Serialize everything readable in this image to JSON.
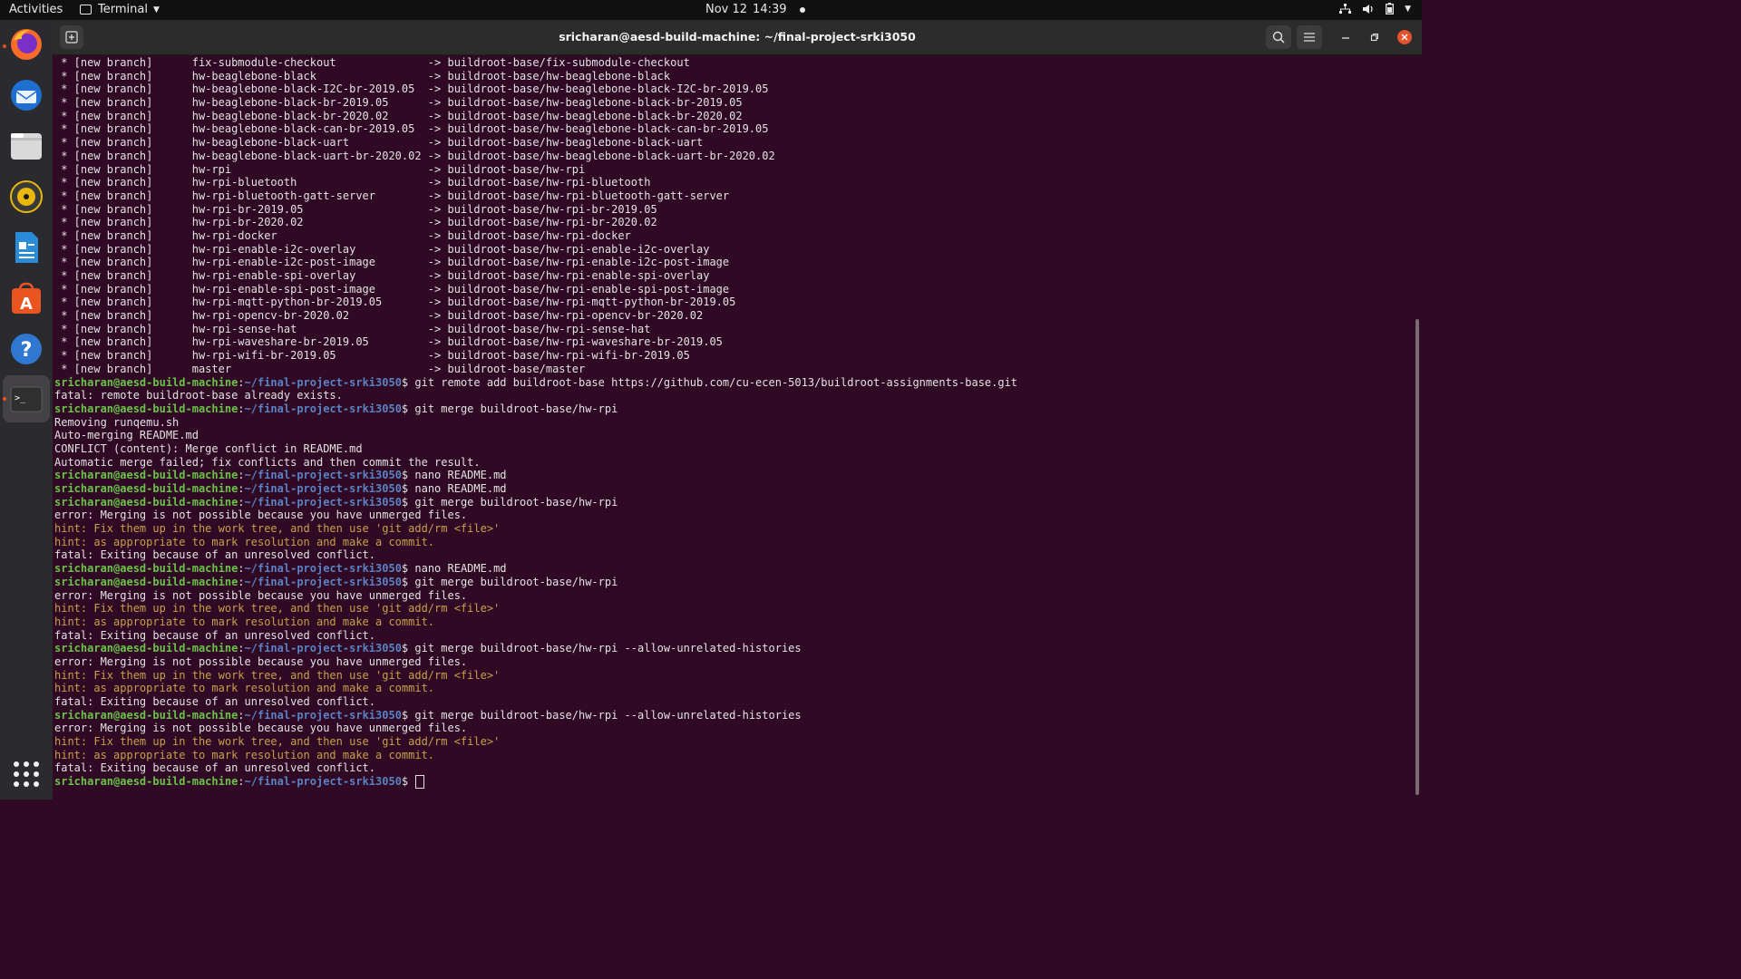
{
  "topbar": {
    "activities": "Activities",
    "app_name": "Terminal",
    "date": "Nov 12",
    "time": "14:39"
  },
  "dock": {
    "items": [
      "firefox-icon",
      "thunderbird-icon",
      "files-icon",
      "rhythmbox-icon",
      "libreoffice-writer-icon",
      "software-icon",
      "help-icon",
      "terminal-icon"
    ]
  },
  "window": {
    "title": "sricharan@aesd-build-machine: ~/final-project-srki3050"
  },
  "prompt": {
    "user": "sricharan@aesd-build-machine",
    "path": "~/final-project-srki3050"
  },
  "terminal_lines": [
    {
      "type": "out",
      "text": " * [new branch]      fix-submodule-checkout              -> buildroot-base/fix-submodule-checkout"
    },
    {
      "type": "out",
      "text": " * [new branch]      hw-beaglebone-black                 -> buildroot-base/hw-beaglebone-black"
    },
    {
      "type": "out",
      "text": " * [new branch]      hw-beaglebone-black-I2C-br-2019.05  -> buildroot-base/hw-beaglebone-black-I2C-br-2019.05"
    },
    {
      "type": "out",
      "text": " * [new branch]      hw-beaglebone-black-br-2019.05      -> buildroot-base/hw-beaglebone-black-br-2019.05"
    },
    {
      "type": "out",
      "text": " * [new branch]      hw-beaglebone-black-br-2020.02      -> buildroot-base/hw-beaglebone-black-br-2020.02"
    },
    {
      "type": "out",
      "text": " * [new branch]      hw-beaglebone-black-can-br-2019.05  -> buildroot-base/hw-beaglebone-black-can-br-2019.05"
    },
    {
      "type": "out",
      "text": " * [new branch]      hw-beaglebone-black-uart            -> buildroot-base/hw-beaglebone-black-uart"
    },
    {
      "type": "out",
      "text": " * [new branch]      hw-beaglebone-black-uart-br-2020.02 -> buildroot-base/hw-beaglebone-black-uart-br-2020.02"
    },
    {
      "type": "out",
      "text": " * [new branch]      hw-rpi                              -> buildroot-base/hw-rpi"
    },
    {
      "type": "out",
      "text": " * [new branch]      hw-rpi-bluetooth                    -> buildroot-base/hw-rpi-bluetooth"
    },
    {
      "type": "out",
      "text": " * [new branch]      hw-rpi-bluetooth-gatt-server        -> buildroot-base/hw-rpi-bluetooth-gatt-server"
    },
    {
      "type": "out",
      "text": " * [new branch]      hw-rpi-br-2019.05                   -> buildroot-base/hw-rpi-br-2019.05"
    },
    {
      "type": "out",
      "text": " * [new branch]      hw-rpi-br-2020.02                   -> buildroot-base/hw-rpi-br-2020.02"
    },
    {
      "type": "out",
      "text": " * [new branch]      hw-rpi-docker                       -> buildroot-base/hw-rpi-docker"
    },
    {
      "type": "out",
      "text": " * [new branch]      hw-rpi-enable-i2c-overlay           -> buildroot-base/hw-rpi-enable-i2c-overlay"
    },
    {
      "type": "out",
      "text": " * [new branch]      hw-rpi-enable-i2c-post-image        -> buildroot-base/hw-rpi-enable-i2c-post-image"
    },
    {
      "type": "out",
      "text": " * [new branch]      hw-rpi-enable-spi-overlay           -> buildroot-base/hw-rpi-enable-spi-overlay"
    },
    {
      "type": "out",
      "text": " * [new branch]      hw-rpi-enable-spi-post-image        -> buildroot-base/hw-rpi-enable-spi-post-image"
    },
    {
      "type": "out",
      "text": " * [new branch]      hw-rpi-mqtt-python-br-2019.05       -> buildroot-base/hw-rpi-mqtt-python-br-2019.05"
    },
    {
      "type": "out",
      "text": " * [new branch]      hw-rpi-opencv-br-2020.02            -> buildroot-base/hw-rpi-opencv-br-2020.02"
    },
    {
      "type": "out",
      "text": " * [new branch]      hw-rpi-sense-hat                    -> buildroot-base/hw-rpi-sense-hat"
    },
    {
      "type": "out",
      "text": " * [new branch]      hw-rpi-waveshare-br-2019.05         -> buildroot-base/hw-rpi-waveshare-br-2019.05"
    },
    {
      "type": "out",
      "text": " * [new branch]      hw-rpi-wifi-br-2019.05              -> buildroot-base/hw-rpi-wifi-br-2019.05"
    },
    {
      "type": "out",
      "text": " * [new branch]      master                              -> buildroot-base/master"
    },
    {
      "type": "cmd",
      "text": "$ git remote add buildroot-base https://github.com/cu-ecen-5013/buildroot-assignments-base.git"
    },
    {
      "type": "out",
      "text": "fatal: remote buildroot-base already exists."
    },
    {
      "type": "cmd",
      "text": "$ git merge buildroot-base/hw-rpi"
    },
    {
      "type": "out",
      "text": "Removing runqemu.sh"
    },
    {
      "type": "out",
      "text": "Auto-merging README.md"
    },
    {
      "type": "out",
      "text": "CONFLICT (content): Merge conflict in README.md"
    },
    {
      "type": "out",
      "text": "Automatic merge failed; fix conflicts and then commit the result."
    },
    {
      "type": "cmd",
      "text": "$ nano README.md"
    },
    {
      "type": "cmd",
      "text": "$ nano README.md"
    },
    {
      "type": "cmd",
      "text": "$ git merge buildroot-base/hw-rpi"
    },
    {
      "type": "out",
      "text": "error: Merging is not possible because you have unmerged files."
    },
    {
      "type": "hint",
      "text": "hint: Fix them up in the work tree, and then use 'git add/rm <file>'"
    },
    {
      "type": "hint",
      "text": "hint: as appropriate to mark resolution and make a commit."
    },
    {
      "type": "out",
      "text": "fatal: Exiting because of an unresolved conflict."
    },
    {
      "type": "cmd",
      "text": "$ nano README.md"
    },
    {
      "type": "cmd",
      "text": "$ git merge buildroot-base/hw-rpi"
    },
    {
      "type": "out",
      "text": "error: Merging is not possible because you have unmerged files."
    },
    {
      "type": "hint",
      "text": "hint: Fix them up in the work tree, and then use 'git add/rm <file>'"
    },
    {
      "type": "hint",
      "text": "hint: as appropriate to mark resolution and make a commit."
    },
    {
      "type": "out",
      "text": "fatal: Exiting because of an unresolved conflict."
    },
    {
      "type": "cmd",
      "text": "$ git merge buildroot-base/hw-rpi --allow-unrelated-histories"
    },
    {
      "type": "out",
      "text": "error: Merging is not possible because you have unmerged files."
    },
    {
      "type": "hint",
      "text": "hint: Fix them up in the work tree, and then use 'git add/rm <file>'"
    },
    {
      "type": "hint",
      "text": "hint: as appropriate to mark resolution and make a commit."
    },
    {
      "type": "out",
      "text": "fatal: Exiting because of an unresolved conflict."
    },
    {
      "type": "cmd",
      "text": "$ git merge buildroot-base/hw-rpi --allow-unrelated-histories"
    },
    {
      "type": "out",
      "text": "error: Merging is not possible because you have unmerged files."
    },
    {
      "type": "hint",
      "text": "hint: Fix them up in the work tree, and then use 'git add/rm <file>'"
    },
    {
      "type": "hint",
      "text": "hint: as appropriate to mark resolution and make a commit."
    },
    {
      "type": "out",
      "text": "fatal: Exiting because of an unresolved conflict."
    },
    {
      "type": "cmd",
      "text": "$ "
    }
  ]
}
